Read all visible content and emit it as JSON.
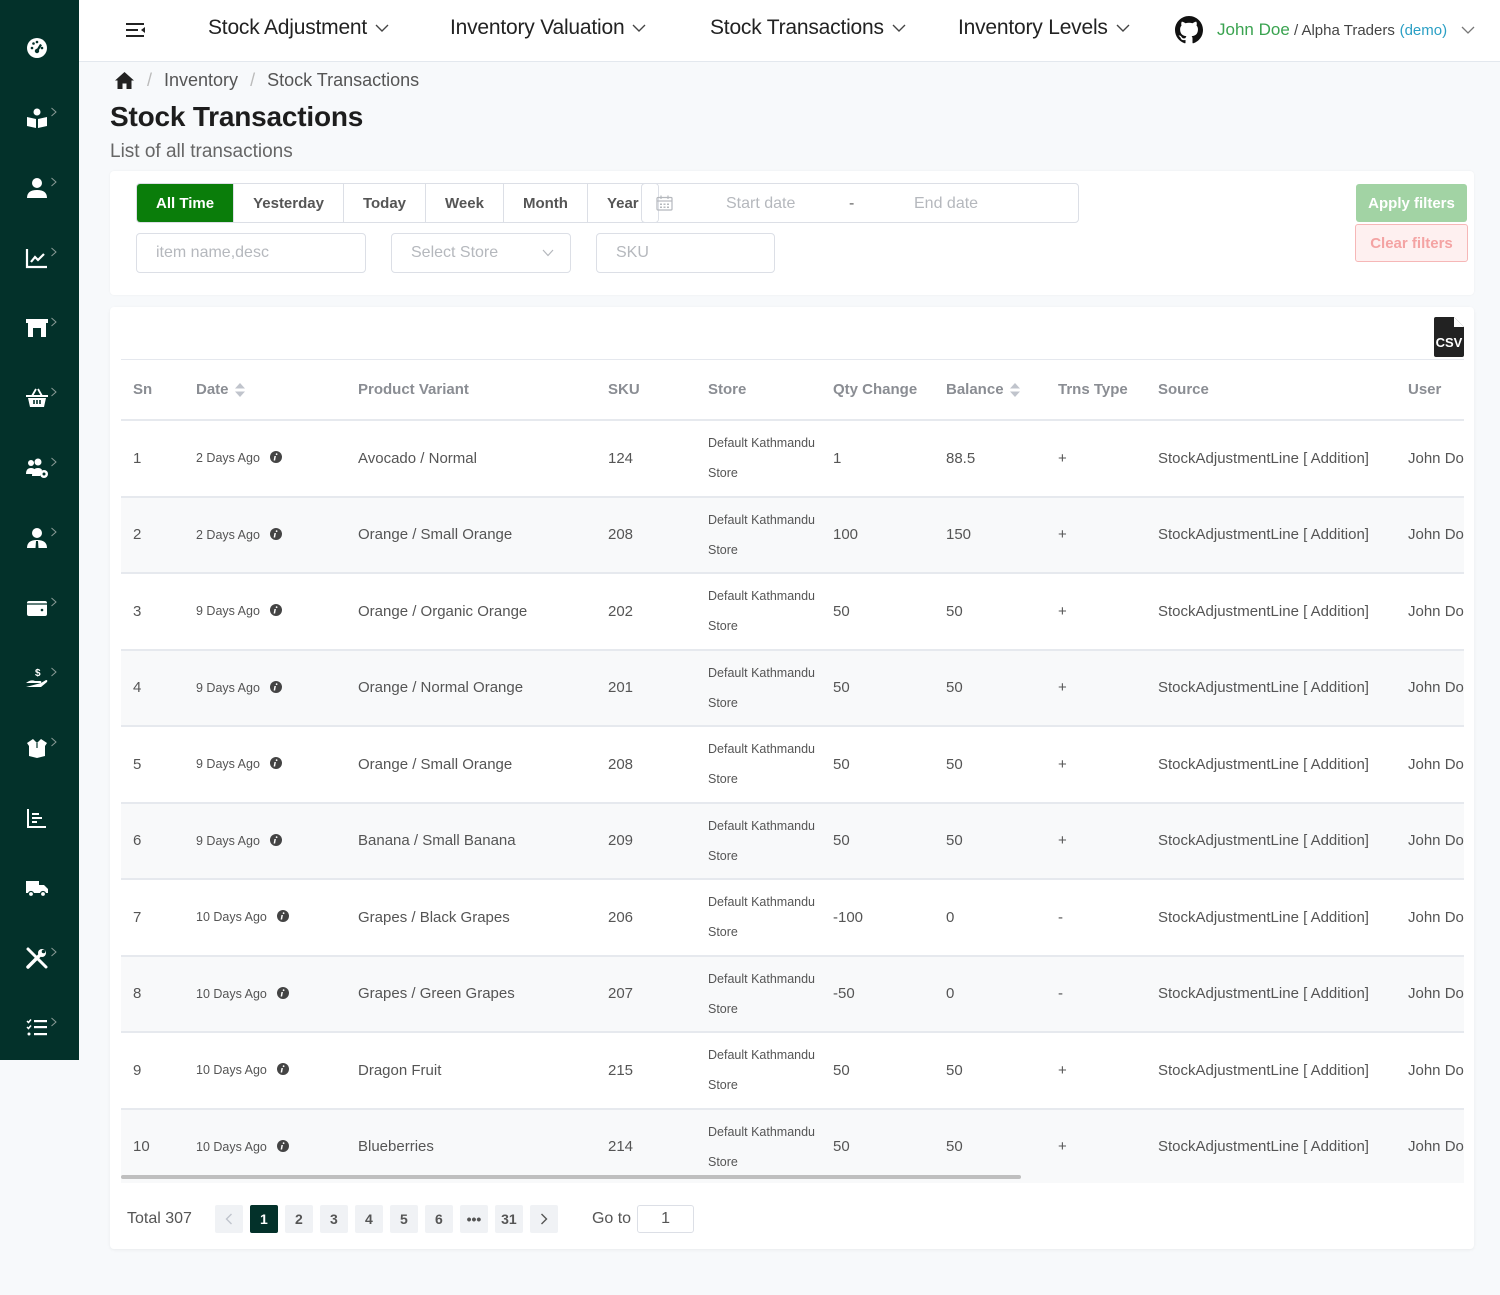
{
  "sidebar": {
    "items": [
      {
        "name": "dashboard",
        "icon": "gauge-icon",
        "has_chevron": false
      },
      {
        "name": "catalog",
        "icon": "book-reader-icon",
        "has_chevron": true
      },
      {
        "name": "users",
        "icon": "user-icon",
        "has_chevron": true
      },
      {
        "name": "analytics",
        "icon": "chart-line-icon",
        "has_chevron": true
      },
      {
        "name": "stores",
        "icon": "store-icon",
        "has_chevron": true
      },
      {
        "name": "purchases",
        "icon": "basket-icon",
        "has_chevron": true
      },
      {
        "name": "user-groups",
        "icon": "users-cog-icon",
        "has_chevron": true
      },
      {
        "name": "staff",
        "icon": "user-tie-icon",
        "has_chevron": true
      },
      {
        "name": "wallet",
        "icon": "wallet-icon",
        "has_chevron": true
      },
      {
        "name": "payments",
        "icon": "hand-dollar-icon",
        "has_chevron": true
      },
      {
        "name": "inventory",
        "icon": "box-open-icon",
        "has_chevron": true
      },
      {
        "name": "reports",
        "icon": "bar-chart-icon",
        "has_chevron": false
      },
      {
        "name": "delivery",
        "icon": "truck-icon",
        "has_chevron": false
      },
      {
        "name": "tools",
        "icon": "tools-icon",
        "has_chevron": true
      },
      {
        "name": "tasks",
        "icon": "tasks-icon",
        "has_chevron": true
      }
    ]
  },
  "topbar": {
    "nav": [
      {
        "label": "Stock Adjustment"
      },
      {
        "label": "Inventory Valuation"
      },
      {
        "label": "Stock Transactions"
      },
      {
        "label": "Inventory Levels"
      }
    ],
    "user": {
      "name": "John Doe",
      "separator": " / ",
      "org": "Alpha Traders",
      "demo": "(demo)"
    }
  },
  "breadcrumb": {
    "items": [
      "Inventory",
      "Stock Transactions"
    ],
    "separator": "/"
  },
  "page": {
    "title": "Stock Transactions",
    "subtitle": "List of all transactions"
  },
  "filters": {
    "periods": [
      "All Time",
      "Yesterday",
      "Today",
      "Week",
      "Month",
      "Year"
    ],
    "active_period": "All Time",
    "start_date_placeholder": "Start date",
    "date_separator": "-",
    "end_date_placeholder": "End date",
    "search_placeholder": "item name,desc",
    "store_placeholder": "Select Store",
    "sku_placeholder": "SKU",
    "apply_label": "Apply filters",
    "clear_label": "Clear filters"
  },
  "table": {
    "export_label": "CSV",
    "columns": [
      "Sn",
      "Date",
      "Product Variant",
      "SKU",
      "Store",
      "Qty Change",
      "Balance",
      "Trns Type",
      "Source",
      "User"
    ],
    "rows": [
      {
        "sn": "1",
        "date": "2 Days Ago",
        "variant": "Avocado / Normal",
        "sku": "124",
        "store": "Default Kathmandu Store",
        "qty": "1",
        "balance": "88.5",
        "type": "+",
        "source": "StockAdjustmentLine [ Addition]",
        "user": "John Doe"
      },
      {
        "sn": "2",
        "date": "2 Days Ago",
        "variant": "Orange / Small Orange",
        "sku": "208",
        "store": "Default Kathmandu Store",
        "qty": "100",
        "balance": "150",
        "type": "+",
        "source": "StockAdjustmentLine [ Addition]",
        "user": "John Doe"
      },
      {
        "sn": "3",
        "date": "9 Days Ago",
        "variant": "Orange / Organic Orange",
        "sku": "202",
        "store": "Default Kathmandu Store",
        "qty": "50",
        "balance": "50",
        "type": "+",
        "source": "StockAdjustmentLine [ Addition]",
        "user": "John Doe"
      },
      {
        "sn": "4",
        "date": "9 Days Ago",
        "variant": "Orange / Normal Orange",
        "sku": "201",
        "store": "Default Kathmandu Store",
        "qty": "50",
        "balance": "50",
        "type": "+",
        "source": "StockAdjustmentLine [ Addition]",
        "user": "John Doe"
      },
      {
        "sn": "5",
        "date": "9 Days Ago",
        "variant": "Orange / Small Orange",
        "sku": "208",
        "store": "Default Kathmandu Store",
        "qty": "50",
        "balance": "50",
        "type": "+",
        "source": "StockAdjustmentLine [ Addition]",
        "user": "John Doe"
      },
      {
        "sn": "6",
        "date": "9 Days Ago",
        "variant": "Banana / Small Banana",
        "sku": "209",
        "store": "Default Kathmandu Store",
        "qty": "50",
        "balance": "50",
        "type": "+",
        "source": "StockAdjustmentLine [ Addition]",
        "user": "John Doe"
      },
      {
        "sn": "7",
        "date": "10 Days Ago",
        "variant": "Grapes / Black Grapes",
        "sku": "206",
        "store": "Default Kathmandu Store",
        "qty": "-100",
        "balance": "0",
        "type": "-",
        "source": "StockAdjustmentLine [ Addition]",
        "user": "John Doe"
      },
      {
        "sn": "8",
        "date": "10 Days Ago",
        "variant": "Grapes / Green Grapes",
        "sku": "207",
        "store": "Default Kathmandu Store",
        "qty": "-50",
        "balance": "0",
        "type": "-",
        "source": "StockAdjustmentLine [ Addition]",
        "user": "John Doe"
      },
      {
        "sn": "9",
        "date": "10 Days Ago",
        "variant": "Dragon Fruit",
        "sku": "215",
        "store": "Default Kathmandu Store",
        "qty": "50",
        "balance": "50",
        "type": "+",
        "source": "StockAdjustmentLine [ Addition]",
        "user": "John Doe"
      },
      {
        "sn": "10",
        "date": "10 Days Ago",
        "variant": "Blueberries",
        "sku": "214",
        "store": "Default Kathmandu Store",
        "qty": "50",
        "balance": "50",
        "type": "+",
        "source": "StockAdjustmentLine [ Addition]",
        "user": "John Doe"
      }
    ]
  },
  "pagination": {
    "total_label": "Total 307",
    "pages": [
      "1",
      "2",
      "3",
      "4",
      "5",
      "6",
      "•••",
      "31"
    ],
    "current_page": "1",
    "goto_label": "Go to",
    "goto_value": "1"
  },
  "colors": {
    "sidebar_bg": "#03312a",
    "active_period": "#0a7d0a",
    "apply_button": "#a2d3a4",
    "clear_button_text": "#f4a3a3",
    "user_name": "#3aa350",
    "demo_tag": "#2a9fc4",
    "active_page": "#03312a"
  }
}
